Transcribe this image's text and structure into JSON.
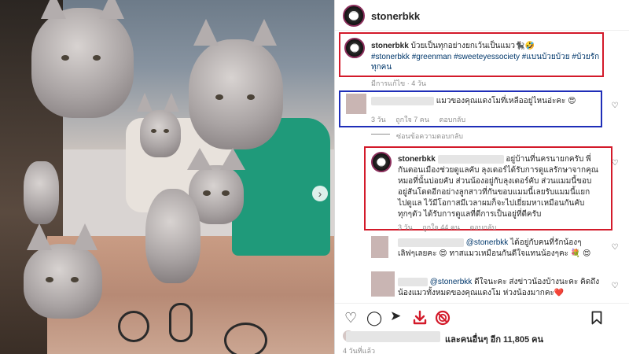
{
  "post": {
    "username": "stonerbkk",
    "caption_text": "บ้วยเป็นทุกอย่างยกเว้นเป็นแมว🐈‍⬛🤣",
    "hashtags_line1": "#stonerbkk #greenman #sweeteyessociety #แบนบ้วยบ้วย #บ้วยรัก",
    "hashtags_line2": "ทุกคน",
    "caption_meta": "มีการแก้ไข · 4 วัน"
  },
  "comments": [
    {
      "text": "แมวของคุณแดงโมที่เหลืออยู่ไหนอ่ะคะ 😍",
      "time": "3 วัน",
      "likes": "ถูกใจ 7 คน",
      "reply": "ตอบกลับ"
    },
    {
      "view_replies": "ซ่อนข้อความตอบกลับ"
    },
    {
      "username": "stonerbkk",
      "text_line1": "อยู่บ้านที่นครนายกครับ พี่",
      "text_line2": "กันตอนเมืองช่วยดูแลคับ ลุงเดอร์ได้รับการดูแลรักษาจากคุณ",
      "text_line3": "หมอที่นั้นบ่อยคับ ส่วนน้องอยู่กับลุงเดอร์คับ ส่วนแมมนี้ขอบ",
      "text_line4": "อยู่สันโดดอีกอย่างลูกสาวที่กันขอบแมมนี้เลยรับแมมนี้แยก",
      "text_line5": "ไปดูแล ไว้มีโอกาสมีเวลาผมก็จะไปเยี่ยมหาเหมือนกันคับ",
      "text_line6": "ทุกๆตัว ได้รับการดูแลที่ดีการเป็นอยู่ที่ดีครับ",
      "time": "3 วัน",
      "likes": "ถูกใจ 44 คน",
      "reply": "ตอบกลับ"
    },
    {
      "mention": "@stonerbkk",
      "text_line1": "ได้อยู่กับคนที่รักน้องๆ",
      "text_line2": "เลิฟๆเลยคะ 😍 ทาสแมวเหมือนกันดีใจแทนน้องๆคะ 💐 😍"
    },
    {
      "mention": "@stonerbkk",
      "text_line1": "ดีใจนะคะ ส่งข่าวน้องบ้างนะคะ คิดถึง",
      "text_line2": "น้องแมวทั้งหมดของคุณแดงโม ห่วงน้องมากคะ❤️"
    }
  ],
  "footer": {
    "likes_text": "และคนอื่นๆ อีก 11,805 คน",
    "time_text": "4 วันที่แล้ว"
  },
  "icons": {
    "heart": "heart-icon",
    "comment": "comment-icon",
    "share": "share-icon",
    "download": "download-icon",
    "no_sign": "no-sign-icon",
    "bookmark": "bookmark-icon"
  },
  "colors": {
    "highlight_red": "#d31a2a",
    "highlight_blue": "#1f2eb8",
    "hashtag": "#00376b",
    "download_icon": "#d31a2a",
    "no_sign_icon": "#d31a2a"
  }
}
